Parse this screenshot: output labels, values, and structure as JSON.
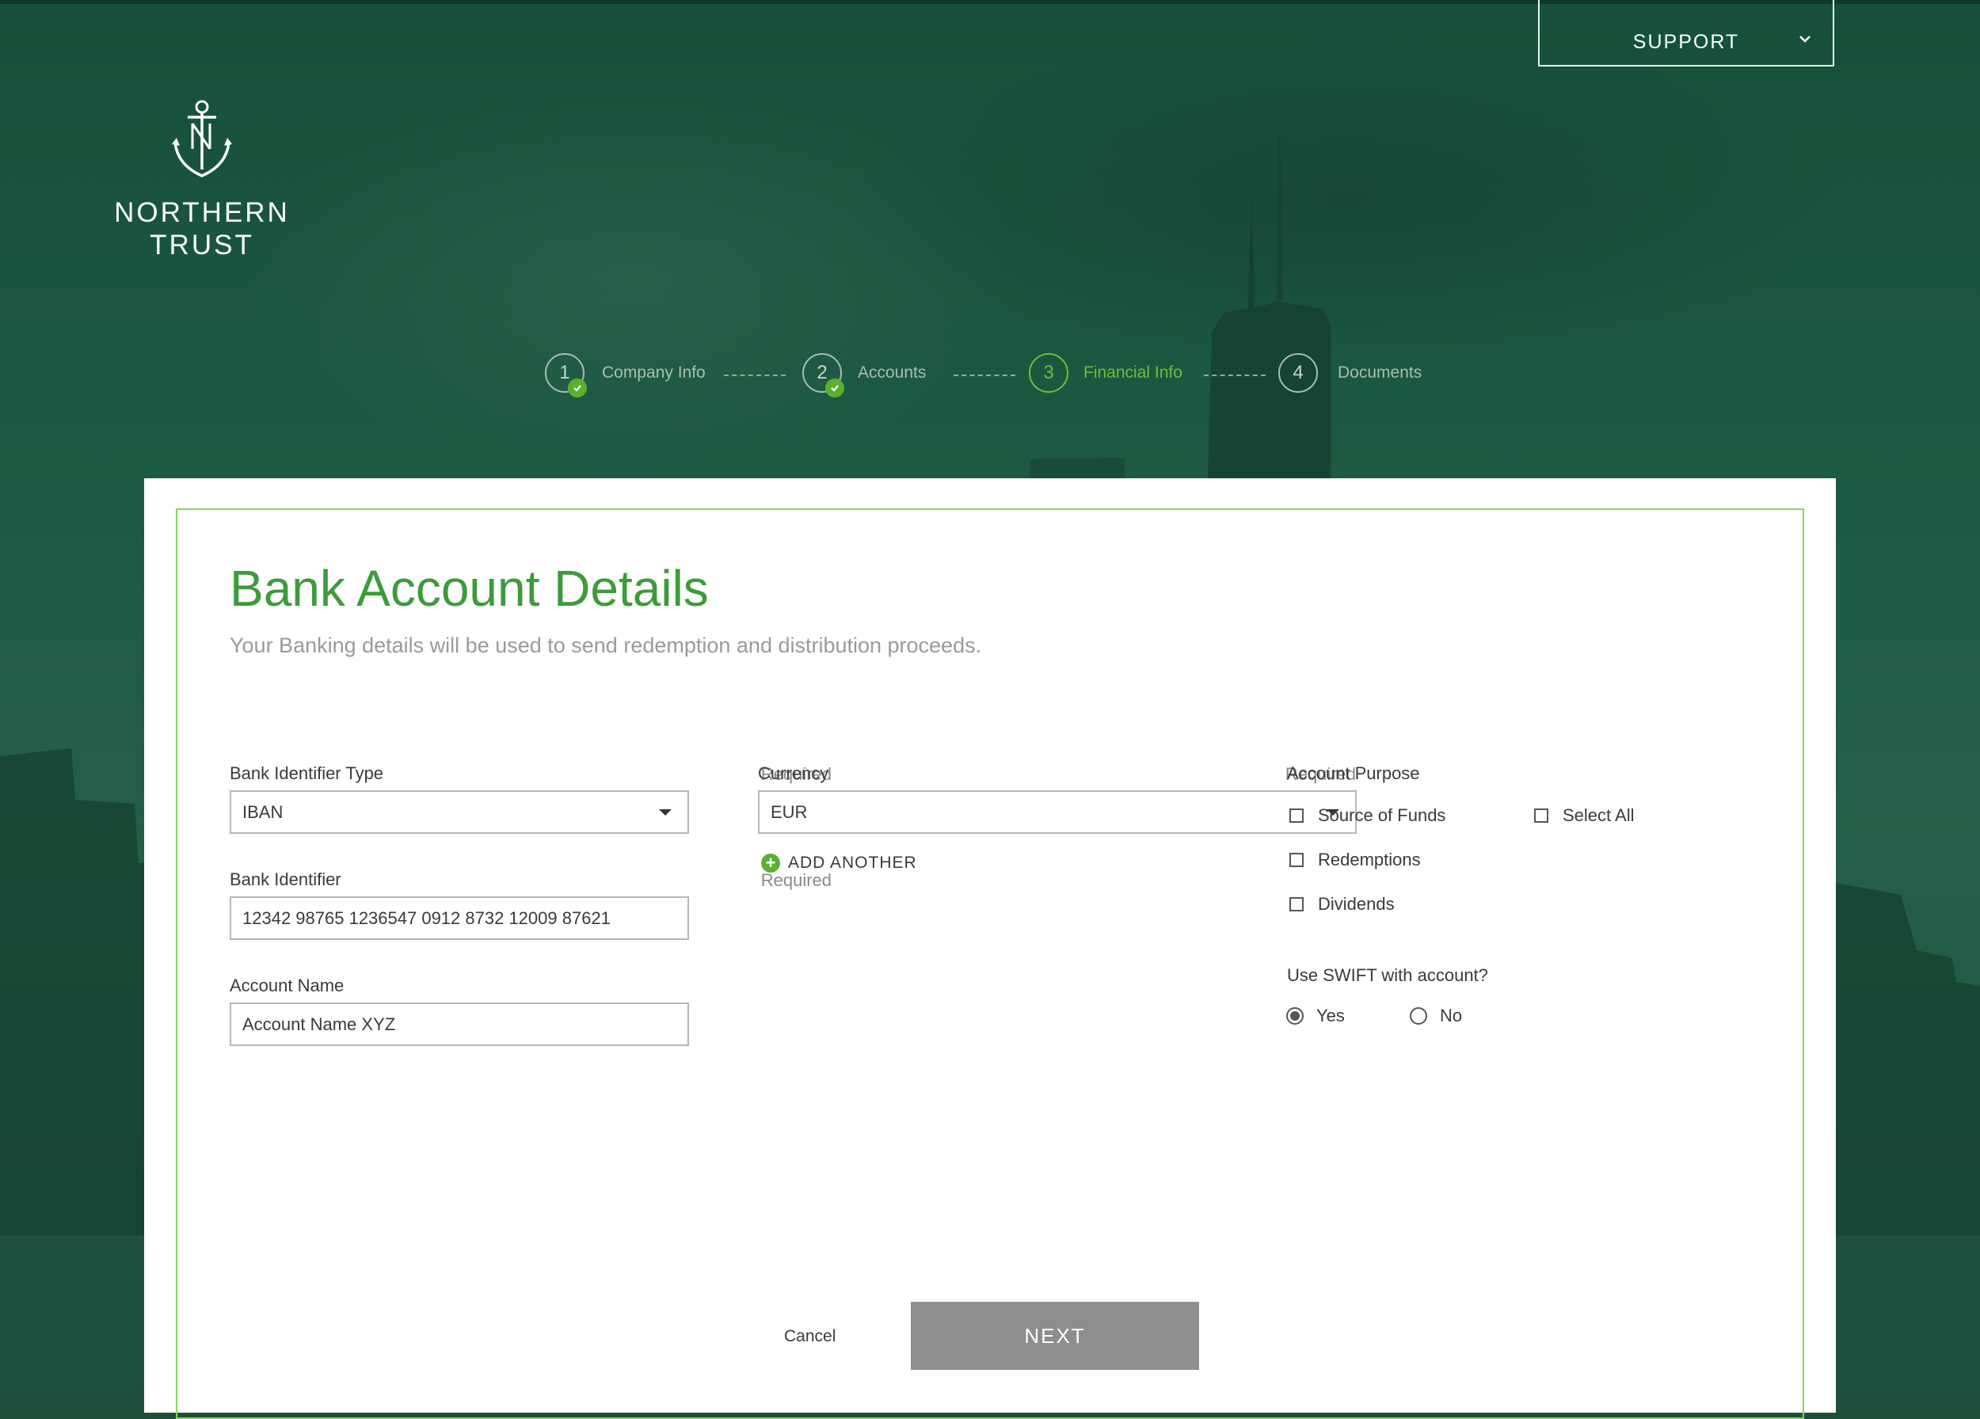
{
  "header": {
    "support_label": "SUPPORT",
    "logo": {
      "line1": "NORTHERN",
      "line2": "TRUST",
      "icon": "anchor-icon"
    }
  },
  "stepper": {
    "steps": [
      {
        "number": "1",
        "label": "Company Info",
        "status": "complete"
      },
      {
        "number": "2",
        "label": "Accounts",
        "status": "complete"
      },
      {
        "number": "3",
        "label": "Financial Info",
        "status": "active"
      },
      {
        "number": "4",
        "label": "Documents",
        "status": "pending"
      }
    ]
  },
  "form": {
    "title": "Bank Account Details",
    "subtitle": "Your Banking details will be used to send redemption and distribution proceeds.",
    "bank_identifier_type": {
      "label": "Bank Identifier Type",
      "required": "Required",
      "value": "IBAN"
    },
    "bank_identifier": {
      "label": "Bank Identifier",
      "required": "Required",
      "value": "12342 98765 1236547 0912 8732 12009 87621"
    },
    "account_name": {
      "label": "Account Name",
      "value": "Account Name XYZ"
    },
    "currency": {
      "label": "Currency",
      "required": "Required",
      "value": "EUR",
      "add_another": "ADD ANOTHER"
    },
    "account_purpose": {
      "label": "Account Purpose",
      "options": [
        "Source of Funds",
        "Redemptions",
        "Dividends"
      ],
      "select_all": "Select All"
    },
    "swift": {
      "label": "Use SWIFT with account?",
      "yes": "Yes",
      "no": "No",
      "selected": "Yes"
    }
  },
  "actions": {
    "cancel": "Cancel",
    "next": "NEXT"
  },
  "colors": {
    "brand_green": "#3e9a3a",
    "accent_green": "#5bb030",
    "frame_green": "#8bd35f",
    "next_disabled": "#8e8e8e"
  }
}
